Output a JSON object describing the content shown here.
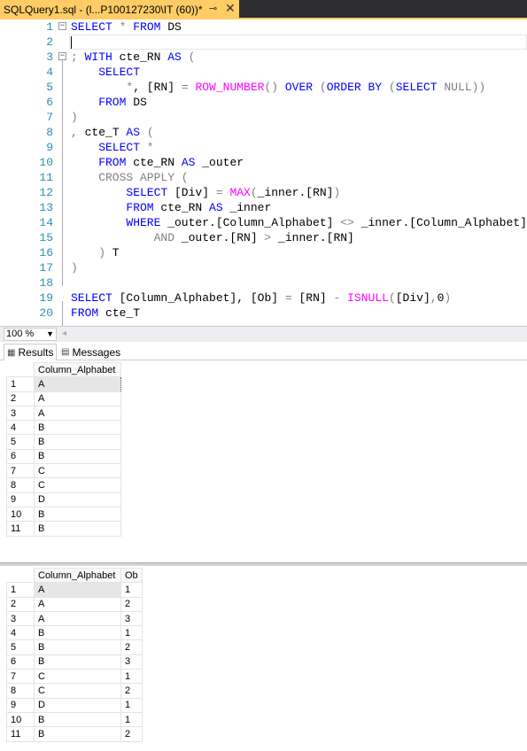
{
  "tab": {
    "title": "SQLQuery1.sql - (l...P100127230\\IT (60))*",
    "pin_icon": "pin-icon",
    "close_glyph": "✕"
  },
  "editor": {
    "lines": [
      {
        "n": "1"
      },
      {
        "n": "2"
      },
      {
        "n": "3"
      },
      {
        "n": "4"
      },
      {
        "n": "5"
      },
      {
        "n": "6"
      },
      {
        "n": "7"
      },
      {
        "n": "8"
      },
      {
        "n": "9"
      },
      {
        "n": "10"
      },
      {
        "n": "11"
      },
      {
        "n": "12"
      },
      {
        "n": "13"
      },
      {
        "n": "14"
      },
      {
        "n": "15"
      },
      {
        "n": "16"
      },
      {
        "n": "17"
      },
      {
        "n": "18"
      },
      {
        "n": "19"
      },
      {
        "n": "20"
      }
    ],
    "code": {
      "l1": [
        "SELECT",
        " * ",
        "FROM",
        " DS"
      ],
      "l3": [
        "; ",
        "WITH",
        " cte_RN ",
        "AS",
        " ("
      ],
      "l4": [
        "SELECT"
      ],
      "l5": [
        "*",
        ", [RN] ",
        "=",
        " ",
        "ROW_NUMBER",
        "() ",
        "OVER",
        " (",
        "ORDER BY",
        " (",
        "SELECT",
        " ",
        "NULL",
        "))"
      ],
      "l6": [
        "FROM",
        " DS"
      ],
      "l7": [
        ")"
      ],
      "l8": [
        ", ",
        "cte_T ",
        "AS",
        " ("
      ],
      "l9": [
        "SELECT",
        " *"
      ],
      "l10": [
        "FROM",
        " cte_RN ",
        "AS",
        " _outer"
      ],
      "l11": [
        "CROSS APPLY (",
        ""
      ],
      "l12": [
        "SELECT",
        " [Div] ",
        "=",
        " ",
        "MAX",
        "(",
        "_inner.[RN]",
        ")"
      ],
      "l13": [
        "FROM",
        " cte_RN ",
        "AS",
        " _inner"
      ],
      "l14": [
        "WHERE",
        " _outer.[Column_Alphabet] ",
        "<>",
        " _inner.[Column_Alphabet]"
      ],
      "l15": [
        "AND",
        " _outer.[RN] ",
        ">",
        " _inner.[RN]"
      ],
      "l16": [
        ") ",
        "T"
      ],
      "l17": [
        ")"
      ],
      "l19": [
        "SELECT",
        " [Column_Alphabet], [Ob] ",
        "=",
        " [RN] ",
        "-",
        " ",
        "ISNULL",
        "(",
        "[Div]",
        ",",
        "0",
        ")"
      ],
      "l20": [
        "FROM",
        " cte_T"
      ]
    }
  },
  "zoom": {
    "value": "100 %"
  },
  "results_tabs": {
    "results": "Results",
    "messages": "Messages"
  },
  "grid1": {
    "headers": [
      "Column_Alphabet"
    ],
    "rows": [
      [
        "1",
        "A"
      ],
      [
        "2",
        "A"
      ],
      [
        "3",
        "A"
      ],
      [
        "4",
        "B"
      ],
      [
        "5",
        "B"
      ],
      [
        "6",
        "B"
      ],
      [
        "7",
        "C"
      ],
      [
        "8",
        "C"
      ],
      [
        "9",
        "D"
      ],
      [
        "10",
        "B"
      ],
      [
        "11",
        "B"
      ]
    ]
  },
  "grid2": {
    "headers": [
      "Column_Alphabet",
      "Ob"
    ],
    "rows": [
      [
        "1",
        "A",
        "1"
      ],
      [
        "2",
        "A",
        "2"
      ],
      [
        "3",
        "A",
        "3"
      ],
      [
        "4",
        "B",
        "1"
      ],
      [
        "5",
        "B",
        "2"
      ],
      [
        "6",
        "B",
        "3"
      ],
      [
        "7",
        "C",
        "1"
      ],
      [
        "8",
        "C",
        "2"
      ],
      [
        "9",
        "D",
        "1"
      ],
      [
        "10",
        "B",
        "1"
      ],
      [
        "11",
        "B",
        "2"
      ]
    ]
  }
}
